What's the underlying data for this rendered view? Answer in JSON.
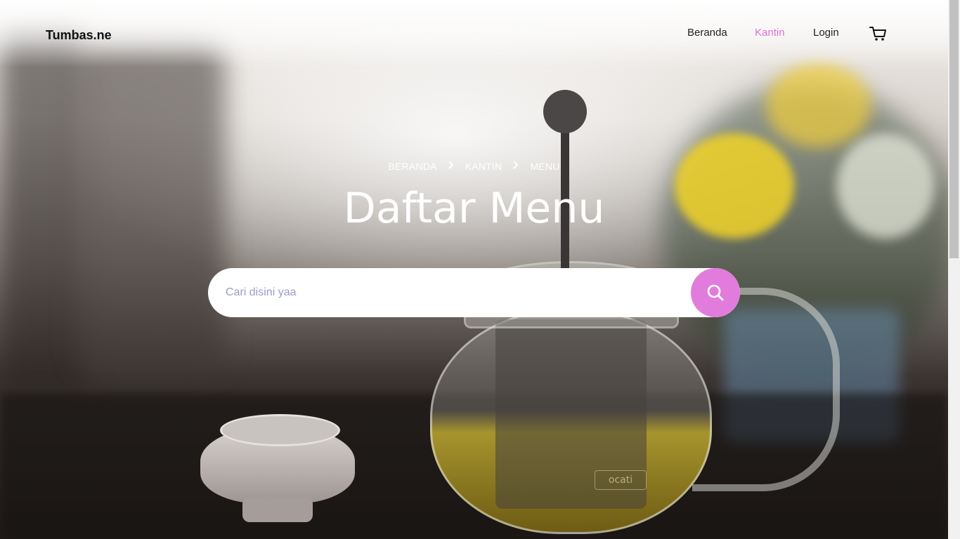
{
  "brand": "Tumbas.ne",
  "nav": {
    "items": [
      {
        "label": "Beranda"
      },
      {
        "label": "Kantin"
      },
      {
        "label": "Login"
      }
    ],
    "active_color": "#e06fd4",
    "cart_icon": "cart-icon"
  },
  "hero": {
    "breadcrumb": [
      "BERANDA",
      "KANTIN",
      "MENU"
    ],
    "title": "Daftar Menu",
    "brand_mark": "ocati"
  },
  "search": {
    "placeholder": "Cari disini yaa",
    "value": "",
    "button_icon": "search-icon",
    "accent": "#e27cdc"
  }
}
